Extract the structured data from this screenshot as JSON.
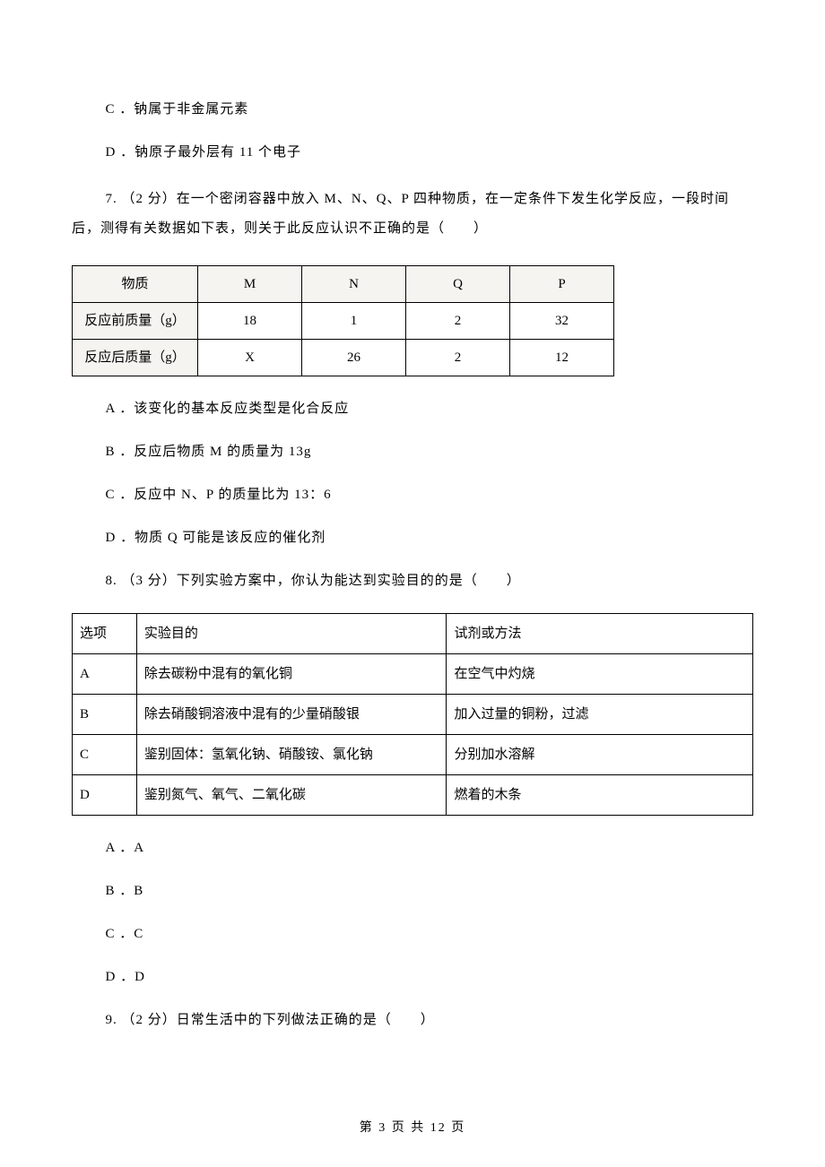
{
  "q6": {
    "optC": "C ．钠属于非金属元素",
    "optD": "D ．钠原子最外层有 11 个电子"
  },
  "q7": {
    "stem": "7. （2 分）在一个密闭容器中放入 M、N、Q、P 四种物质，在一定条件下发生化学反应，一段时间后，测得有关数据如下表，则关于此反应认识不正确的是（　　）",
    "table": {
      "headers": [
        "物质",
        "M",
        "N",
        "Q",
        "P"
      ],
      "rows": [
        {
          "label": "反应前质量（g）",
          "cells": [
            "18",
            "1",
            "2",
            "32"
          ]
        },
        {
          "label": "反应后质量（g）",
          "cells": [
            "X",
            "26",
            "2",
            "12"
          ]
        }
      ]
    },
    "optA": "A ．该变化的基本反应类型是化合反应",
    "optB": "B ．反应后物质 M 的质量为 13g",
    "optC": "C ．反应中 N、P 的质量比为 13：6",
    "optD": "D ．物质 Q 可能是该反应的催化剂"
  },
  "q8": {
    "stem": "8. （3 分）下列实验方案中，你认为能达到实验目的的是（　　）",
    "table": {
      "headers": [
        "选项",
        "实验目的",
        "试剂或方法"
      ],
      "rows": [
        {
          "opt": "A",
          "purpose": "除去碳粉中混有的氧化铜",
          "method": "在空气中灼烧"
        },
        {
          "opt": "B",
          "purpose": "除去硝酸铜溶液中混有的少量硝酸银",
          "method": "加入过量的铜粉，过滤"
        },
        {
          "opt": "C",
          "purpose": "鉴别固体：氢氧化钠、硝酸铵、氯化钠",
          "method": "分别加水溶解"
        },
        {
          "opt": "D",
          "purpose": "鉴别氮气、氧气、二氧化碳",
          "method": "燃着的木条"
        }
      ]
    },
    "optA": "A ．A",
    "optB": "B ．B",
    "optC": "C ．C",
    "optD": "D ．D"
  },
  "q9": {
    "stem": "9. （2 分）日常生活中的下列做法正确的是（　　）"
  },
  "footer": "第 3 页 共 12 页"
}
